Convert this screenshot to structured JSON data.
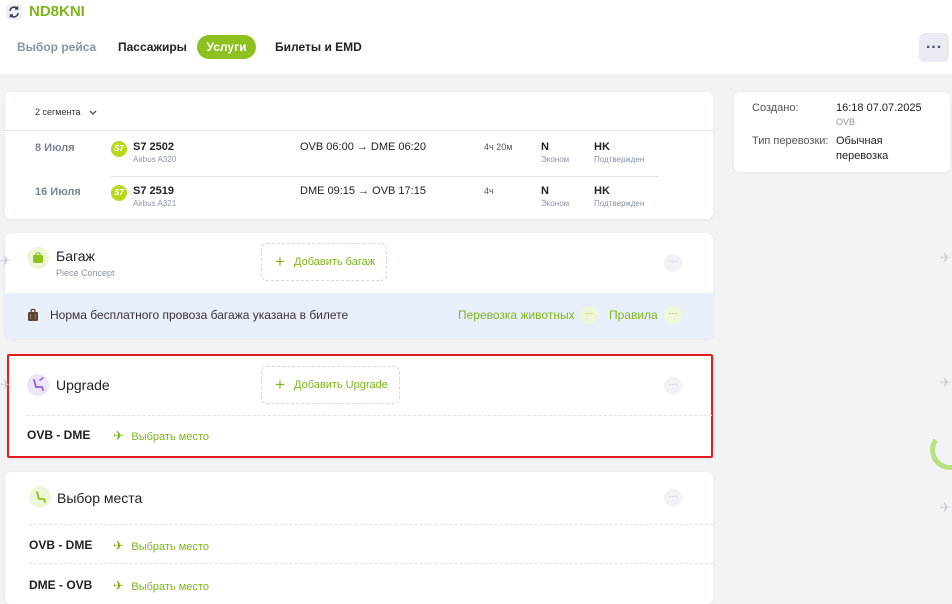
{
  "header": {
    "pnr": "ND8KNI",
    "tabs": [
      {
        "label": "Выбор рейса"
      },
      {
        "label": "Пассажиры"
      },
      {
        "label": "Услуги"
      },
      {
        "label": "Билеты и EMD"
      }
    ],
    "more": "..."
  },
  "segments": {
    "toggle_label": "2 сегмента",
    "rows": [
      {
        "date": "8 Июля",
        "airline_logo": "S7",
        "flight": "S7 2502",
        "aircraft": "Airbus A320",
        "route": "OVB 06:00 → DME 06:20",
        "duration": "4ч 20м",
        "class_code": "N",
        "class_name": "Эконом",
        "status_code": "HK",
        "status_name": "Подтвержден"
      },
      {
        "date": "16 Июля",
        "airline_logo": "S7",
        "flight": "S7 2519",
        "aircraft": "Airbus A321",
        "route": "DME 09:15 → OVB 17:15",
        "duration": "4ч",
        "class_code": "N",
        "class_name": "Эконом",
        "status_code": "HK",
        "status_name": "Подтвержден"
      }
    ]
  },
  "booking_info": {
    "created_label": "Создано:",
    "created_value": "16:18 07.07.2025",
    "created_place": "OVB",
    "type_label": "Тип перевозки:",
    "type_value_line1": "Обычная",
    "type_value_line2": "перевозка"
  },
  "baggage": {
    "title": "Багаж",
    "subtitle": "Piece Concept",
    "add_label": "Добавить багаж",
    "banner_text": "Норма бесплатного провоза багажа указана в билете",
    "pets_link": "Перевозка животных",
    "rules_link": "Правила"
  },
  "upgrade": {
    "title": "Upgrade",
    "add_label": "Добавить Upgrade",
    "routes": [
      {
        "route": "OVB - DME",
        "action": "Выбрать место"
      }
    ]
  },
  "seat_selection": {
    "title": "Выбор места",
    "routes": [
      {
        "route": "OVB - DME",
        "action": "Выбрать место"
      },
      {
        "route": "DME - OVB",
        "action": "Выбрать место"
      }
    ]
  },
  "colors": {
    "accent": "#8ec11f",
    "link": "#7cb519",
    "highlight_border": "#e21f1f",
    "banner_bg": "#e9eefb"
  },
  "icons": {
    "pnr": "refresh-icon",
    "baggage": "suitcase-icon",
    "upgrade": "seat-upgrade-icon",
    "seat": "seat-icon",
    "plane": "plane-icon",
    "chevron": "chevron-down-icon"
  }
}
